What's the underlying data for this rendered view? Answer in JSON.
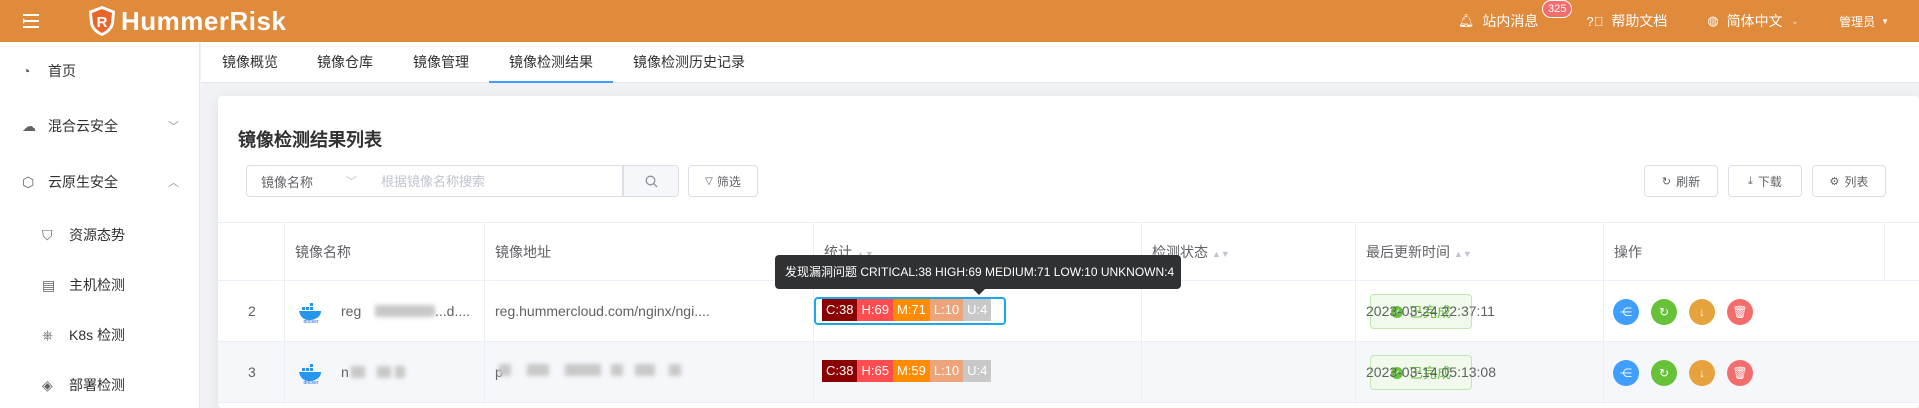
{
  "header": {
    "app_name": "HummerRisk",
    "messages_label": "站内消息",
    "messages_badge": "325",
    "help_label": "帮助文档",
    "language_label": "简体中文",
    "user_label": "管理员"
  },
  "sidebar": {
    "items": [
      {
        "label": "首页",
        "icon": "pie-chart-icon"
      },
      {
        "label": "混合云安全",
        "icon": "cloud-icon"
      },
      {
        "label": "云原生安全",
        "icon": "hexagon-nodes-icon"
      },
      {
        "label": "资源态势",
        "icon": "shield-icon"
      },
      {
        "label": "主机检测",
        "icon": "server-icon"
      },
      {
        "label": "K8s 检测",
        "icon": "k8s-wheel-icon"
      },
      {
        "label": "部署检测",
        "icon": "layers-icon"
      }
    ]
  },
  "tabs": [
    "镜像概览",
    "镜像仓库",
    "镜像管理",
    "镜像检测结果",
    "镜像检测历史记录"
  ],
  "active_tab": "镜像检测结果",
  "main": {
    "title": "镜像检测结果列表",
    "filter_select": "镜像名称",
    "search_placeholder": "根据镜像名称搜索",
    "filter_button": "筛选",
    "refresh_button": "刷新",
    "download_button": "下载",
    "list_button": "列表"
  },
  "table": {
    "columns": [
      "镜像名称",
      "镜像地址",
      "统计",
      "检测状态",
      "最后更新时间",
      "操作"
    ],
    "rows": [
      {
        "index": "2",
        "name": "reg",
        "name_suffix": "...d....",
        "address": "reg.hummercloud.com/nginx/ngi....",
        "stats": [
          "C:38",
          "H:69",
          "M:71",
          "L:10",
          "U:4"
        ],
        "status": "已完成",
        "updated": "2023-03-24 22:37:11"
      },
      {
        "index": "3",
        "name": "n",
        "name_suffix": "",
        "address": "p",
        "stats": [
          "C:38",
          "H:65",
          "M:59",
          "L:10",
          "U:4"
        ],
        "status": "已完成",
        "updated": "2023-03-14 05:13:08"
      }
    ]
  },
  "tooltip": "发现漏洞问题 CRITICAL:38 HIGH:69 MEDIUM:71 LOW:10 UNKNOWN:4",
  "colors": {
    "header": "#e08a3c",
    "critical": "#8b0000",
    "high": "#ff4d4f",
    "medium": "#ff8c00",
    "low": "#eea47a",
    "unknown": "#c8c8c8",
    "share": "#409eff",
    "rescan": "#67c23a",
    "download": "#e6a23c",
    "delete": "#f56c6c"
  }
}
